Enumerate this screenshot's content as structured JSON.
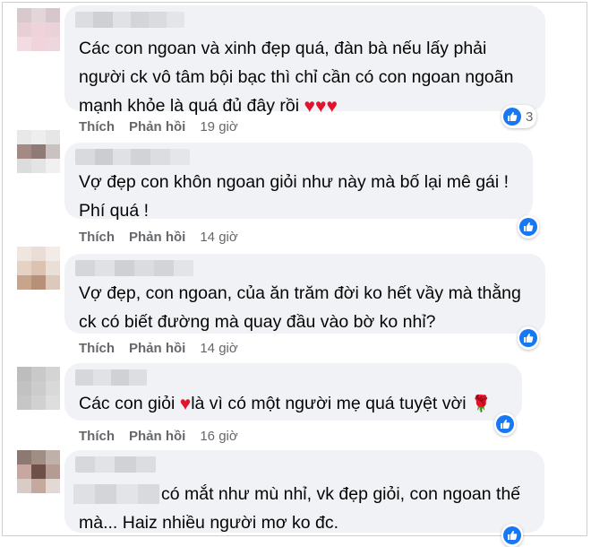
{
  "comments": [
    {
      "lines": [
        "Các con ngoan và xinh đẹp quá, đàn bà nếu lấy phải",
        "người ck vô tâm bội bạc thì chỉ cần có con ngoan ngoãn",
        "mạnh khỏe là quá đủ đây rồi "
      ],
      "hearts": "♥♥♥",
      "like_label": "Thích",
      "reply_label": "Phản hồi",
      "time": "19 giờ",
      "reaction_count": "3"
    },
    {
      "lines": [
        "Vợ đẹp con khôn ngoan giỏi như này mà bố lại mê gái !",
        "Phí quá !"
      ],
      "like_label": "Thích",
      "reply_label": "Phản hồi",
      "time": "14 giờ"
    },
    {
      "lines": [
        "Vợ đẹp, con ngoan, của ăn trăm đời ko hết vầy mà thằng",
        "ck có biết đường mà quay đầu vào bờ ko nhỉ?"
      ],
      "like_label": "Thích",
      "reply_label": "Phản hồi",
      "time": "14 giờ"
    },
    {
      "text_before": "Các con giỏi ",
      "heart": "♥",
      "text_after": "là vì có một người mẹ quá tuyệt vời ",
      "rose": "🌹",
      "like_label": "Thích",
      "reply_label": "Phản hồi",
      "time": "16 giờ"
    },
    {
      "lines": [
        "có mắt như mù nhỉ, vk đẹp giỏi, con ngoan thế",
        "mà... Haiz nhiều người mơ ko đc."
      ]
    }
  ],
  "colors": {
    "bubble": "#f0f2f5",
    "like_blue": "#1877f2",
    "meta_gray": "#65676b",
    "heart_red": "#e0142a"
  },
  "icons": {
    "like": "thumbs-up-icon",
    "heart": "heart-icon",
    "rose": "rose-icon"
  }
}
